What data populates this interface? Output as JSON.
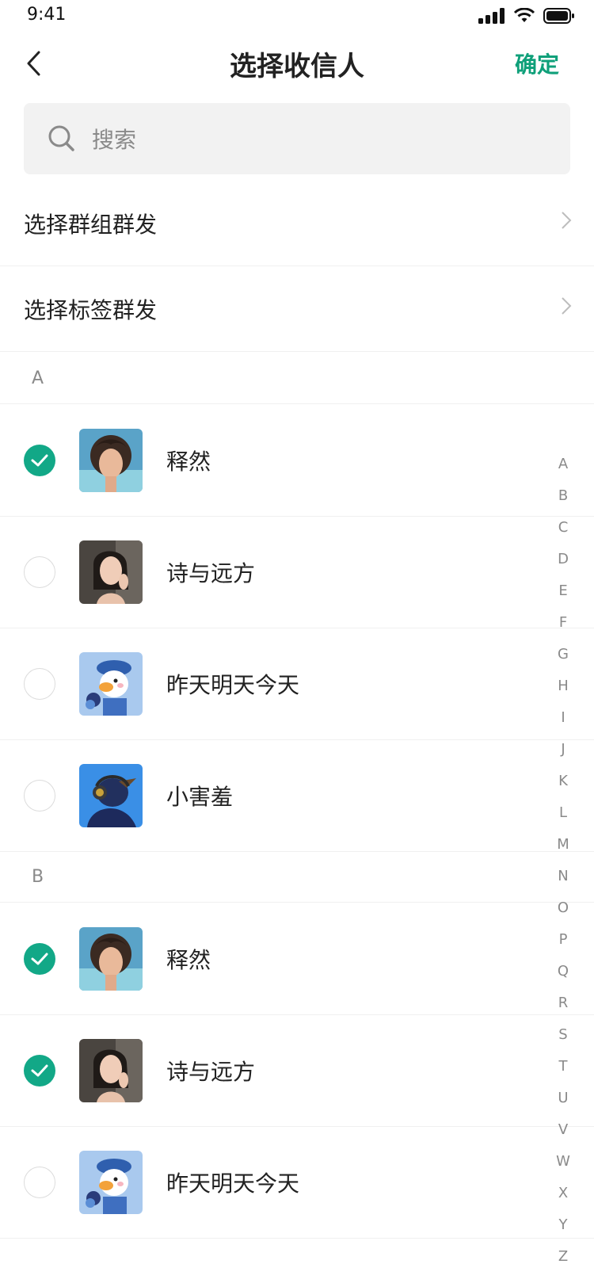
{
  "status_bar": {
    "time": "9:41"
  },
  "nav": {
    "title": "选择收信人",
    "confirm_label": "确定"
  },
  "search": {
    "placeholder": "搜索"
  },
  "entries": [
    {
      "label": "选择群组群发"
    },
    {
      "label": "选择标签群发"
    }
  ],
  "sections": [
    {
      "letter": "A",
      "contacts": [
        {
          "name": "释然",
          "checked": true,
          "avatar": "woman-curly-hair"
        },
        {
          "name": "诗与远方",
          "checked": false,
          "avatar": "woman-portrait"
        },
        {
          "name": "昨天明天今天",
          "checked": false,
          "avatar": "duck-with-flowers"
        },
        {
          "name": "小害羞",
          "checked": false,
          "avatar": "bird-with-headphones"
        }
      ]
    },
    {
      "letter": "B",
      "contacts": [
        {
          "name": "释然",
          "checked": true,
          "avatar": "woman-curly-hair"
        },
        {
          "name": "诗与远方",
          "checked": true,
          "avatar": "woman-portrait"
        },
        {
          "name": "昨天明天今天",
          "checked": false,
          "avatar": "duck-with-flowers"
        }
      ]
    }
  ],
  "alphabet": [
    "A",
    "B",
    "C",
    "D",
    "E",
    "F",
    "G",
    "H",
    "I",
    "J",
    "K",
    "L",
    "M",
    "N",
    "O",
    "P",
    "Q",
    "R",
    "S",
    "T",
    "U",
    "V",
    "W",
    "X",
    "Y",
    "Z"
  ],
  "colors": {
    "accent": "#0fa07a",
    "check": "#12a887"
  }
}
